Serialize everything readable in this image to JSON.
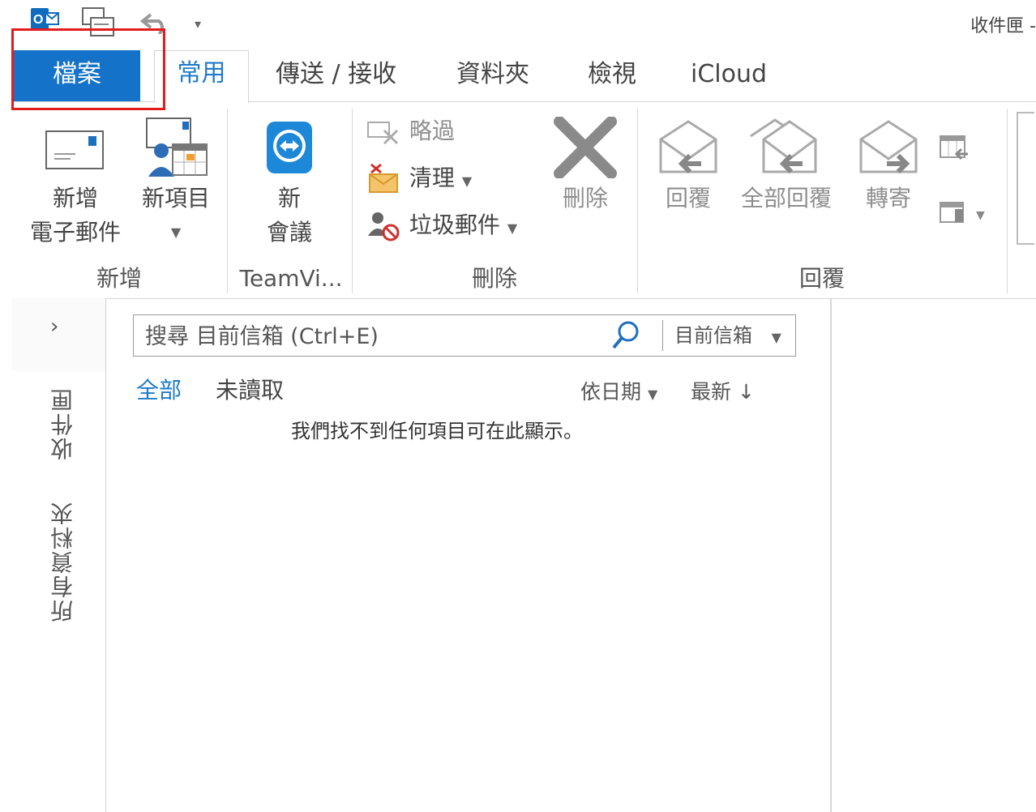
{
  "window": {
    "title": "收件匣 -"
  },
  "tabs": [
    {
      "label": "檔案"
    },
    {
      "label": "常用"
    },
    {
      "label": "傳送 / 接收"
    },
    {
      "label": "資料夾"
    },
    {
      "label": "檢視"
    },
    {
      "label": "iCloud"
    }
  ],
  "ribbon": {
    "new_group": {
      "label": "新增",
      "new_email": "新增\n電子郵件",
      "new_email_l1": "新增",
      "new_email_l2": "電子郵件",
      "new_items": "新項目"
    },
    "teamviewer_group": {
      "label": "TeamVi...",
      "new_meeting_l1": "新",
      "new_meeting_l2": "會議"
    },
    "delete_group": {
      "label": "刪除",
      "ignore": "略過",
      "clean_up": "清理",
      "junk": "垃圾郵件",
      "delete": "刪除"
    },
    "respond_group": {
      "label": "回覆",
      "reply": "回覆",
      "reply_all": "全部回覆",
      "forward": "轉寄"
    }
  },
  "nav": {
    "inbox": "收件匣",
    "all_folders": "所有資料夾"
  },
  "search": {
    "placeholder": "搜尋 目前信箱 (Ctrl+E)",
    "scope": "目前信箱"
  },
  "filters": {
    "all": "全部",
    "unread": "未讀取",
    "by_date": "依日期",
    "newest": "最新 ↓"
  },
  "empty_message": "我們找不到任何項目可在此顯示。",
  "colors": {
    "accent": "#1473c9",
    "highlight": "#e31b1b"
  }
}
